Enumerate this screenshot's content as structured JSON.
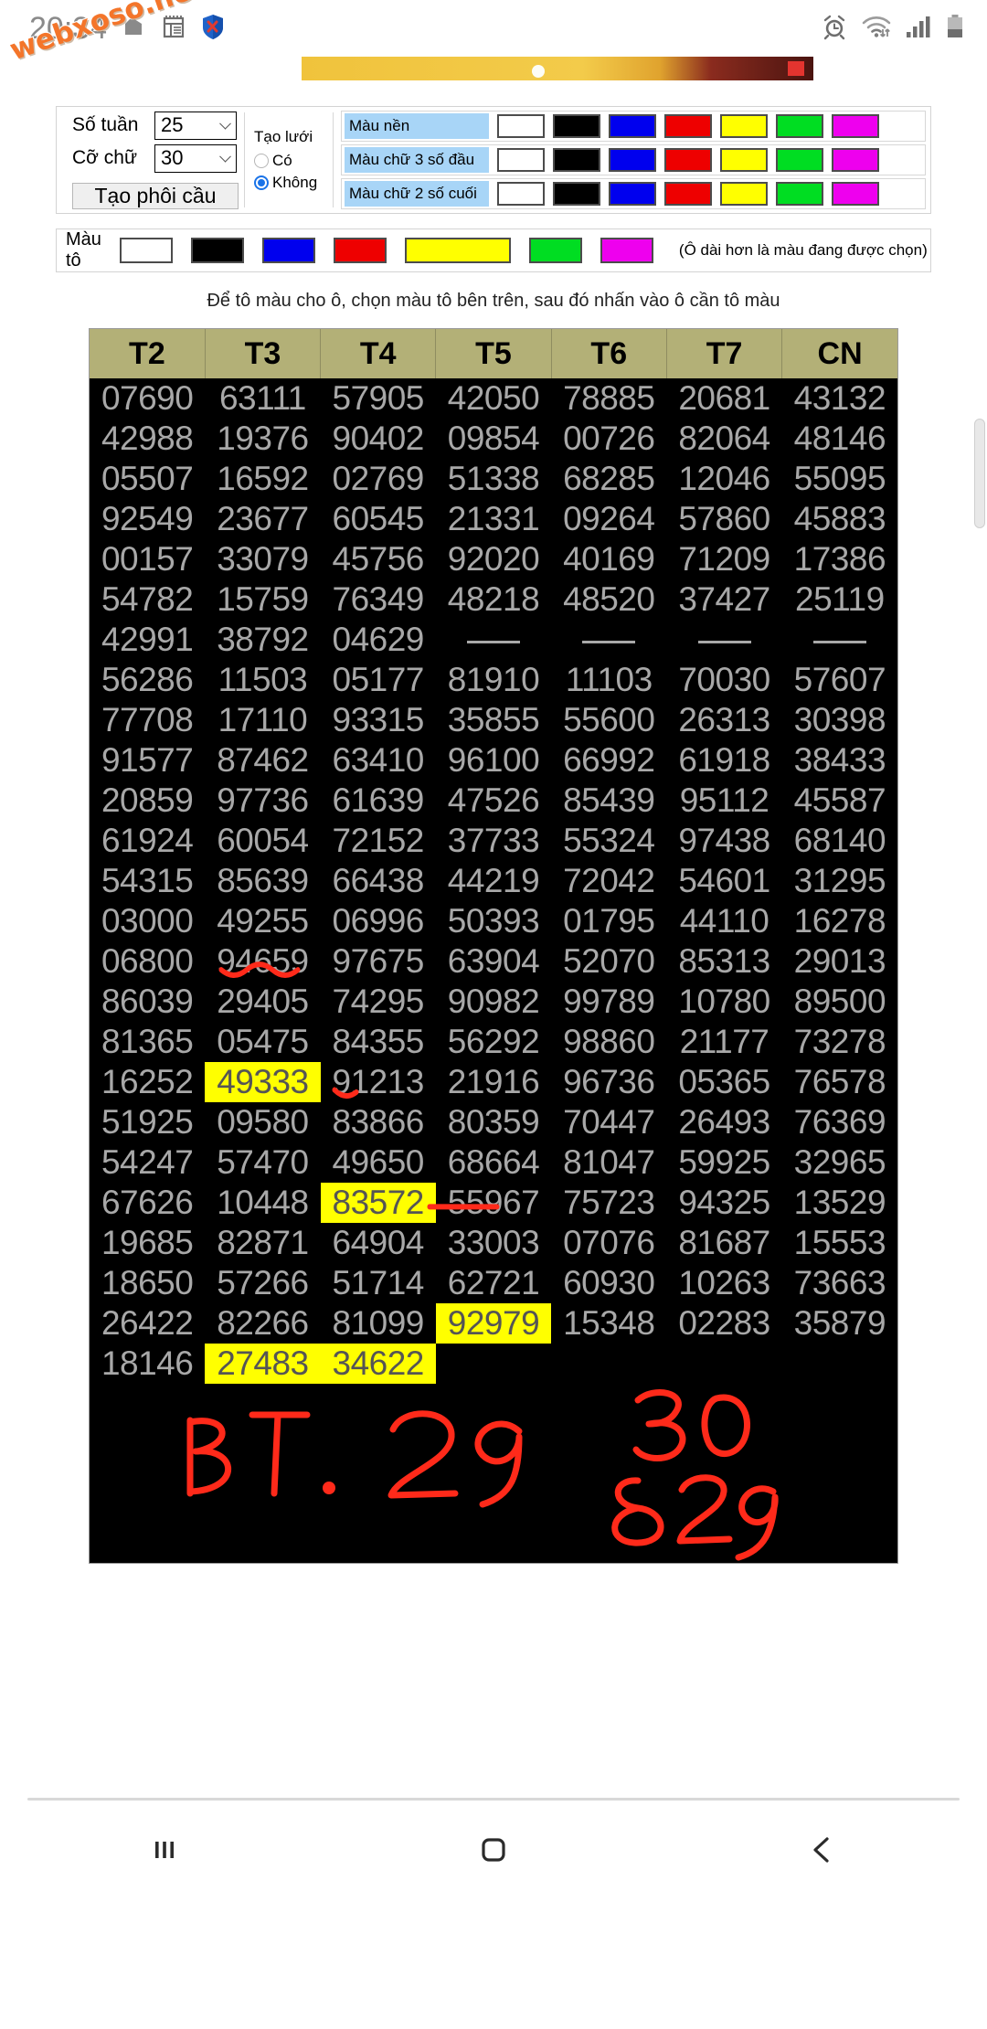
{
  "statusbar": {
    "time": "20:34",
    "left_icons": [
      "screenshot-icon",
      "notes-icon",
      "security-shield-icon"
    ],
    "right_icons": [
      "alarm-icon",
      "wifi-icon",
      "signal-icon",
      "battery-icon"
    ]
  },
  "watermark": {
    "text": "webxoso.net"
  },
  "controls": {
    "weeks": {
      "label": "Số tuần",
      "value": "25"
    },
    "fontsize": {
      "label": "Cỡ chữ",
      "value": "30"
    },
    "generate_button": "Tạo phôi cầu",
    "grid": {
      "label": "Tạo lưới",
      "option_yes": "Có",
      "option_no": "Không",
      "selected": "Không"
    },
    "color_rows": [
      {
        "label": "Màu nền",
        "swatches": [
          "#ffffff",
          "#000000",
          "#0000ee",
          "#ee0000",
          "#ffff00",
          "#00dd22",
          "#ee00ee"
        ],
        "selected_index": -1
      },
      {
        "label": "Màu chữ 3 số đầu",
        "swatches": [
          "#ffffff",
          "#000000",
          "#0000ee",
          "#ee0000",
          "#ffff00",
          "#00dd22",
          "#ee00ee"
        ],
        "selected_index": -1
      },
      {
        "label": "Màu chữ 2 số cuối",
        "swatches": [
          "#ffffff",
          "#000000",
          "#0000ee",
          "#ee0000",
          "#ffff00",
          "#00dd22",
          "#ee00ee"
        ],
        "selected_index": -1
      }
    ],
    "fill": {
      "label": "Màu tô",
      "swatches": [
        "#ffffff",
        "#000000",
        "#0000ee",
        "#ee0000",
        "#ffff00",
        "#00dd22",
        "#ee00ee"
      ],
      "selected_index": 4,
      "hint": "(Ô dài hơn là màu đang được chọn)"
    },
    "instruction": "Để tô màu cho ô, chọn màu tô bên trên, sau đó nhấn vào ô cần tô màu"
  },
  "table": {
    "headers": [
      "T2",
      "T3",
      "T4",
      "T5",
      "T6",
      "T7",
      "CN"
    ],
    "rows": [
      [
        "07690",
        "63111",
        "57905",
        "42050",
        "78885",
        "20681",
        "43132"
      ],
      [
        "42988",
        "19376",
        "90402",
        "09854",
        "00726",
        "82064",
        "48146"
      ],
      [
        "05507",
        "16592",
        "02769",
        "51338",
        "68285",
        "12046",
        "55095"
      ],
      [
        "92549",
        "23677",
        "60545",
        "21331",
        "09264",
        "57860",
        "45883"
      ],
      [
        "00157",
        "33079",
        "45756",
        "92020",
        "40169",
        "71209",
        "17386"
      ],
      [
        "54782",
        "15759",
        "76349",
        "48218",
        "48520",
        "37427",
        "25119"
      ],
      [
        "42991",
        "38792",
        "04629",
        "—",
        "—",
        "—",
        "—"
      ],
      [
        "56286",
        "11503",
        "05177",
        "81910",
        "11103",
        "70030",
        "57607"
      ],
      [
        "77708",
        "17110",
        "93315",
        "35855",
        "55600",
        "26313",
        "30398"
      ],
      [
        "91577",
        "87462",
        "63410",
        "96100",
        "66992",
        "61918",
        "38433"
      ],
      [
        "20859",
        "97736",
        "61639",
        "47526",
        "85439",
        "95112",
        "45587"
      ],
      [
        "61924",
        "60054",
        "72152",
        "37733",
        "55324",
        "97438",
        "68140"
      ],
      [
        "54315",
        "85639",
        "66438",
        "44219",
        "72042",
        "54601",
        "31295"
      ],
      [
        "03000",
        "49255",
        "06996",
        "50393",
        "01795",
        "44110",
        "16278"
      ],
      [
        "06800",
        "94659",
        "97675",
        "63904",
        "52070",
        "85313",
        "29013"
      ],
      [
        "86039",
        "29405",
        "74295",
        "90982",
        "99789",
        "10780",
        "89500"
      ],
      [
        "81365",
        "05475",
        "84355",
        "56292",
        "98860",
        "21177",
        "73278"
      ],
      [
        "16252",
        "49333",
        "91213",
        "21916",
        "96736",
        "05365",
        "76578"
      ],
      [
        "51925",
        "09580",
        "83866",
        "80359",
        "70447",
        "26493",
        "76369"
      ],
      [
        "54247",
        "57470",
        "49650",
        "68664",
        "81047",
        "59925",
        "32965"
      ],
      [
        "67626",
        "10448",
        "83572",
        "55967",
        "75723",
        "94325",
        "13529"
      ],
      [
        "19685",
        "82871",
        "64904",
        "33003",
        "07076",
        "81687",
        "15553"
      ],
      [
        "18650",
        "57266",
        "51714",
        "62721",
        "60930",
        "10263",
        "73663"
      ],
      [
        "26422",
        "82266",
        "81099",
        "92979",
        "15348",
        "02283",
        "35879"
      ],
      [
        "18146",
        "27483",
        "34622",
        "",
        "",
        "",
        ""
      ]
    ],
    "highlighted_cells": [
      [
        17,
        1
      ],
      [
        20,
        2
      ],
      [
        23,
        3
      ],
      [
        24,
        1
      ],
      [
        24,
        2
      ]
    ],
    "highlight_color": "#ffff00",
    "header_bg": "#b3b077",
    "cell_bg": "#000000",
    "cell_text": "#a8a8a8"
  },
  "annotations": {
    "color": "#ff2a1a",
    "notes": [
      {
        "name": "bt-29-note",
        "text": "BT. 29"
      },
      {
        "name": "count-30-note",
        "text": "30"
      },
      {
        "name": "count-829-note",
        "text": "829"
      }
    ]
  },
  "navbar": {
    "recents": "recents-icon",
    "home": "home-icon",
    "back": "back-icon"
  }
}
